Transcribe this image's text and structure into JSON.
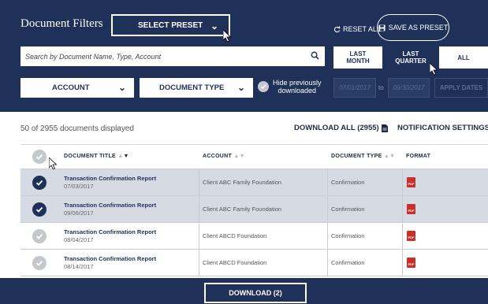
{
  "filters": {
    "title": "Document Filters",
    "preset_label": "SELECT PRESET",
    "reset_label": "RESET ALL",
    "save_preset_label": "SAVE AS PRESET",
    "search_placeholder": "Search by Document Name, Type, Account",
    "period_tabs": [
      {
        "line1": "LAST",
        "line2": "MONTH",
        "active": false
      },
      {
        "line1": "LAST",
        "line2": "QUARTER",
        "active": true
      },
      {
        "line1": "ALL",
        "line2": "",
        "active": false
      }
    ],
    "account_label": "ACCOUNT",
    "doctype_label": "DOCUMENT TYPE",
    "hide_line1": "Hide previously",
    "hide_line2": "downloaded",
    "date_from": "07/01/2017",
    "date_to_label": "to",
    "date_to": "09/30/2017",
    "apply_label": "APPLY DATES"
  },
  "summary": {
    "count_text": "50 of 2955 documents displayed",
    "download_all_label": "DOWNLOAD ALL (2955)",
    "notification_label": "NOTIFICATION SETTINGS"
  },
  "table": {
    "headers": {
      "title": "DOCUMENT TITLE",
      "account": "ACCOUNT",
      "type": "DOCUMENT TYPE",
      "format": "FORMAT"
    },
    "rows": [
      {
        "title": "Transaction Confirmation Report",
        "date": "07/03/2017",
        "account": "Client ABC Family Foundation",
        "type": "Confirmation",
        "format": "PDF",
        "selected": true
      },
      {
        "title": "Transaction Confirmation Report",
        "date": "09/06/2017",
        "account": "Client ABC Family Foundation",
        "type": "Confirmation",
        "format": "PDF",
        "selected": true
      },
      {
        "title": "Transaction Confirmation Report",
        "date": "08/04/2017",
        "account": "Client ABCD Foundation",
        "type": "Confirmation",
        "format": "PDF",
        "selected": false
      },
      {
        "title": "Transaction Confirmation Report",
        "date": "08/14/2017",
        "account": "Client ABCD Foundation",
        "type": "Confirmation",
        "format": "PDF",
        "selected": false
      }
    ]
  },
  "footer": {
    "download_label": "DOWNLOAD (2)"
  },
  "colors": {
    "navy": "#1f3159",
    "selected_row": "#d6dae3",
    "pdf_red": "#c8312a"
  }
}
